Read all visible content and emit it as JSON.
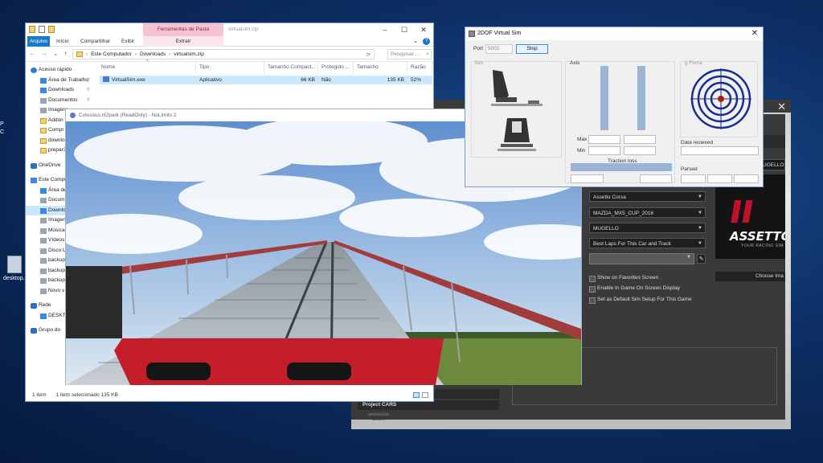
{
  "desktop": {
    "icon_label": "desktop.i",
    "left_strip": [
      "P",
      "C"
    ]
  },
  "explorer": {
    "context_tab": "Ferramentas de Pasta Compactada",
    "window_title": "virtualsim.zip",
    "ribbon_tabs": [
      "Arquivo",
      "Início",
      "Compartilhar",
      "Exibir"
    ],
    "extract_tab": "Extrair",
    "path": [
      "Este Computador",
      "Downloads",
      "virtualsim.zip"
    ],
    "search_placeholder": "Pesquisar ...",
    "columns": [
      "Nome",
      "Tipo",
      "Tamanho Compact...",
      "Protegido ...",
      "Tamanho",
      "Razão"
    ],
    "file": {
      "name": "VirtualSim.exe",
      "type": "Aplicativo",
      "compressed_size": "66 KB",
      "protected": "Não",
      "size": "135 KB",
      "ratio": "52%"
    },
    "nav_quick": [
      "Acesso rápido",
      "Área de Trabalho",
      "Downloads",
      "Documentos",
      "Imagens",
      "Addon",
      "Compr",
      "downlo",
      "prepar3"
    ],
    "nav_onedrive": "OneDrive",
    "nav_pc": [
      "Este Computador",
      "Área de",
      "Docum",
      "Downlo",
      "Imagen",
      "Músicas",
      "Vídeos",
      "Disco L",
      "backup",
      "backup",
      "backup",
      "Novo v"
    ],
    "nav_network": [
      "Rede",
      "DESKTO"
    ],
    "nav_group": "Grupo do",
    "status_count": "1 item",
    "status_selected": "1 item selecionado  135 KB"
  },
  "nolimits": {
    "title": "Colossus.nl2park (ReadOnly) - NoLimits 2"
  },
  "dashboard": {
    "selectors": [
      "Assetto Corsa",
      "MAZDA_MX5_CUP_2016",
      "MUGELLO",
      "Best Laps For This Car and Track"
    ],
    "checkboxes": [
      "Show on Favorites Screen",
      "Enable In Game On Screen Display",
      "Set as Default Sim Setup For This Game"
    ],
    "track_tag": "UGELLO",
    "logo_text": "ASSETTO",
    "logo_sub": "YOUR RACING SIM",
    "choose_button": "Choose Ima",
    "list_items": [
      "Project CARS (Steam)",
      "Project CARS"
    ],
    "zoom_label": "Zoom",
    "close_glyph": "✕"
  },
  "dof": {
    "title": "2DOF Virtual Sim",
    "port_label": "Port",
    "port_value": "5002",
    "stop_button": "Stop",
    "sim_label": "Sim",
    "axis_label": "Axis",
    "gforce_label": "g Force",
    "max_label": "Max",
    "min_label": "Min",
    "traction_label": "Traction loss",
    "data_received_label": "Data received",
    "parsed_label": "Parsed"
  }
}
